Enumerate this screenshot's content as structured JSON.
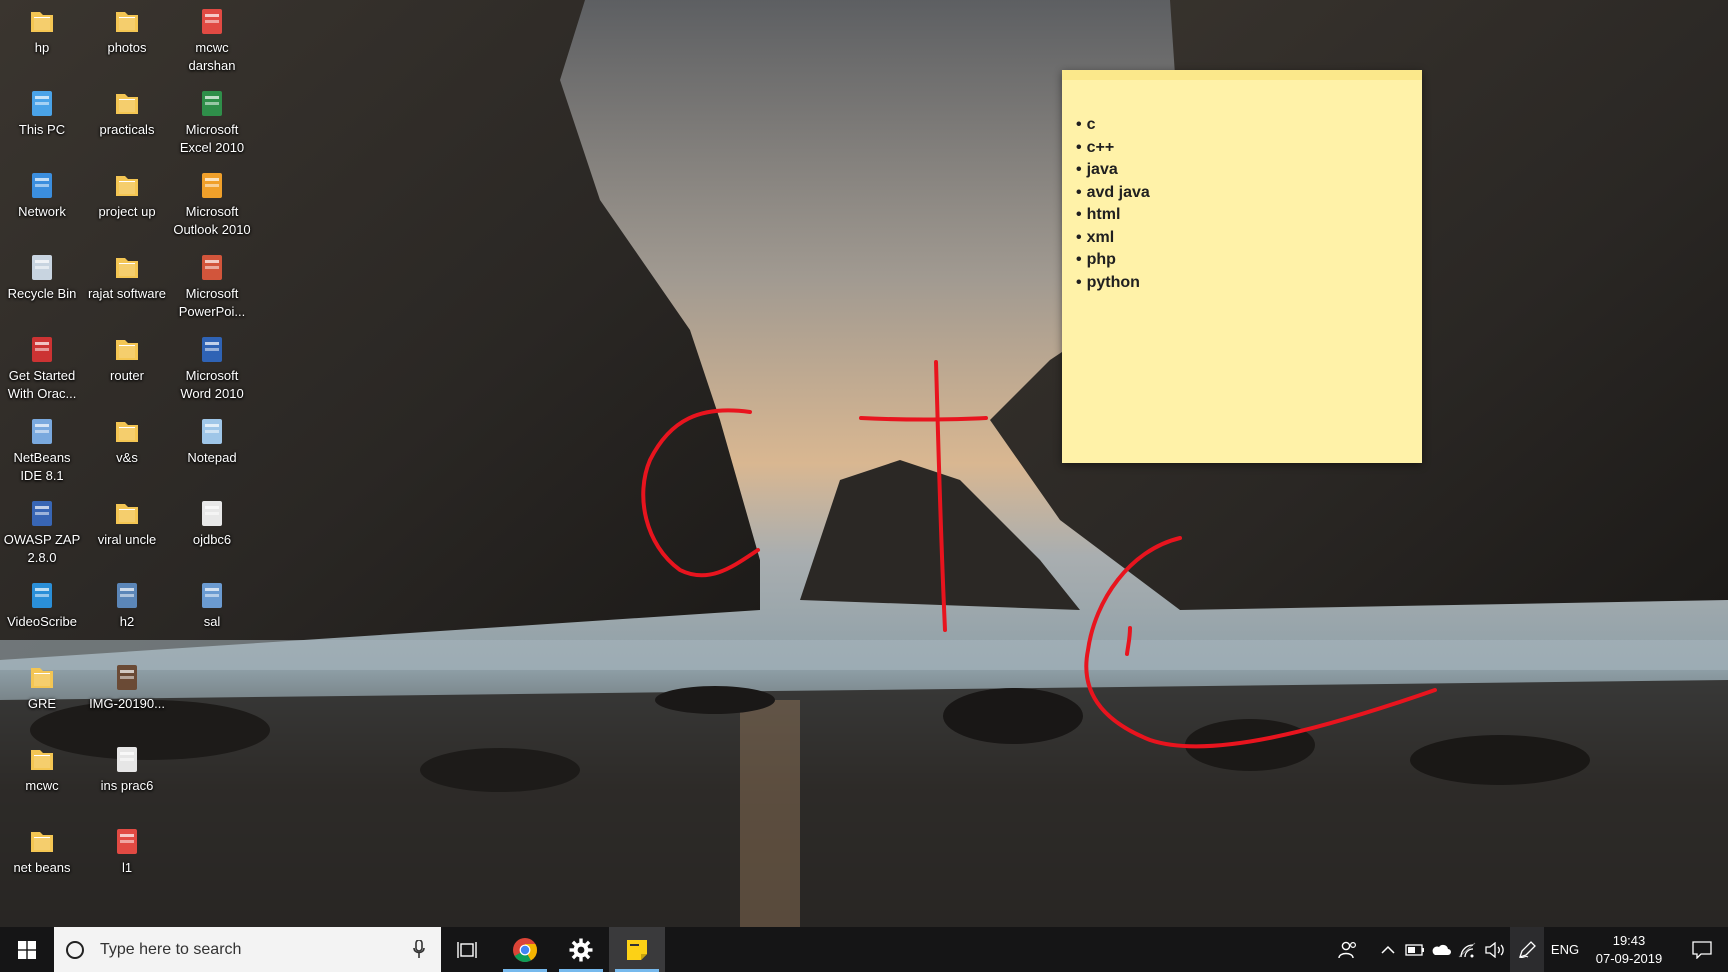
{
  "desktop_icons": [
    {
      "label": "hp",
      "icon": "folder-icon"
    },
    {
      "label": "photos",
      "icon": "folder-icon"
    },
    {
      "label": "mcwc darshan",
      "icon": "pdf-icon"
    },
    {
      "label": "This PC",
      "icon": "computer-icon"
    },
    {
      "label": "practicals",
      "icon": "folder-icon"
    },
    {
      "label": "Microsoft Excel 2010",
      "icon": "excel-icon"
    },
    {
      "label": "Network",
      "icon": "network-icon"
    },
    {
      "label": "project up",
      "icon": "folder-icon"
    },
    {
      "label": "Microsoft Outlook 2010",
      "icon": "outlook-icon"
    },
    {
      "label": "Recycle Bin",
      "icon": "recycle-bin-icon"
    },
    {
      "label": "rajat software",
      "icon": "folder-icon"
    },
    {
      "label": "Microsoft PowerPoi...",
      "icon": "powerpoint-icon"
    },
    {
      "label": "Get Started With Orac...",
      "icon": "oracle-icon"
    },
    {
      "label": "router",
      "icon": "folder-icon"
    },
    {
      "label": "Microsoft Word 2010",
      "icon": "word-icon"
    },
    {
      "label": "NetBeans IDE 8.1",
      "icon": "netbeans-icon"
    },
    {
      "label": "v&s",
      "icon": "folder-icon"
    },
    {
      "label": "Notepad",
      "icon": "notepad-icon"
    },
    {
      "label": "OWASP ZAP 2.8.0",
      "icon": "zap-icon"
    },
    {
      "label": "viral uncle",
      "icon": "folder-icon"
    },
    {
      "label": "ojdbc6",
      "icon": "java-icon"
    },
    {
      "label": "VideoScribe",
      "icon": "videoscribe-icon"
    },
    {
      "label": "h2",
      "icon": "h2-icon"
    },
    {
      "label": "sal",
      "icon": "sal-icon"
    },
    {
      "label": "GRE",
      "icon": "folder-icon"
    },
    {
      "label": "IMG-20190...",
      "icon": "image-file-icon"
    },
    {
      "label": "mcwc",
      "icon": "folder-icon"
    },
    {
      "label": "ins prac6",
      "icon": "document-icon"
    },
    {
      "label": "net beans",
      "icon": "folder-icon"
    },
    {
      "label": "l1",
      "icon": "pdf-icon"
    }
  ],
  "sticky_note": {
    "items": [
      "c",
      "c++",
      "java",
      "avd java",
      "html",
      "xml",
      "php",
      "python"
    ],
    "color": "#fff2a8"
  },
  "ink_color": "#e8141e",
  "taskbar": {
    "search_placeholder": "Type here to search",
    "language": "ENG",
    "time": "19:43",
    "date": "07-09-2019",
    "pinned": [
      "start-icon",
      "task-view-icon",
      "chrome-icon",
      "settings-icon",
      "sticky-notes-icon"
    ],
    "accent": "#76b9ed"
  }
}
